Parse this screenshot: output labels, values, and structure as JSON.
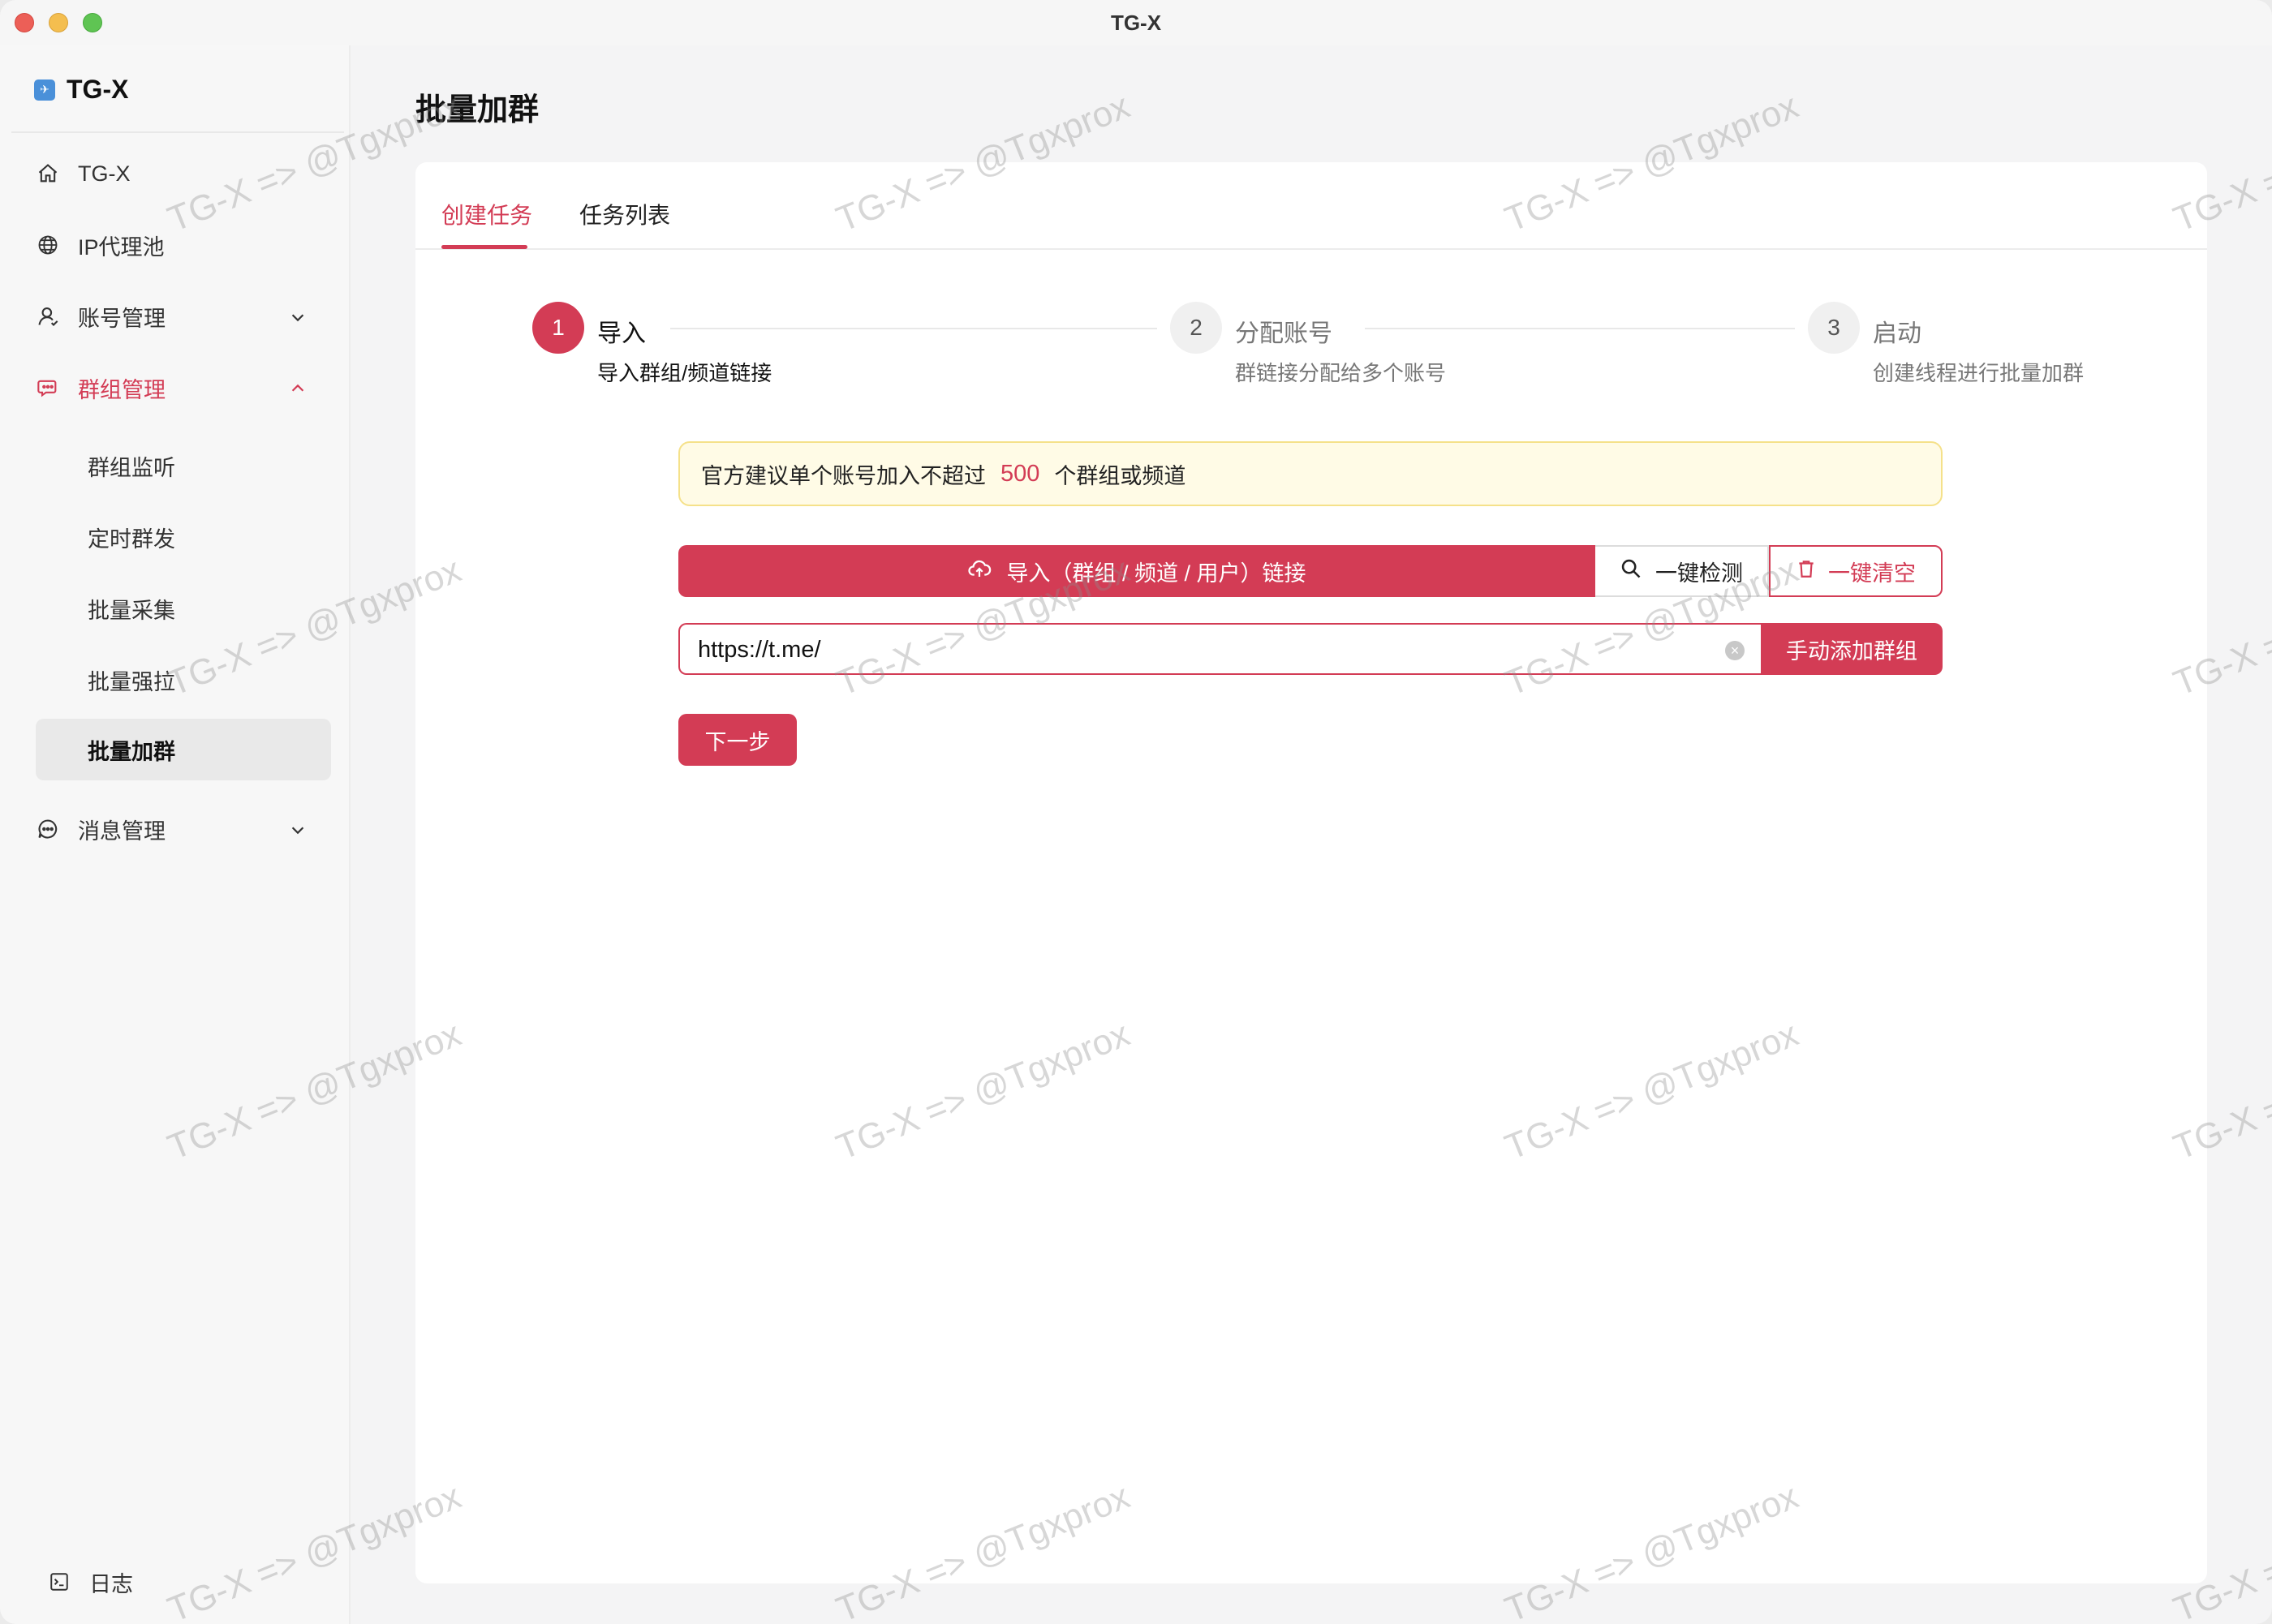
{
  "window": {
    "title": "TG-X"
  },
  "brand": {
    "name": "TG-X"
  },
  "sidebar": {
    "items": [
      {
        "label": "TG-X",
        "icon": "home-icon"
      },
      {
        "label": "IP代理池",
        "icon": "globe-icon"
      },
      {
        "label": "账号管理",
        "icon": "user-icon"
      },
      {
        "label": "群组管理",
        "icon": "chat-group-icon"
      },
      {
        "label": "消息管理",
        "icon": "message-icon"
      }
    ],
    "sub_items": [
      "群组监听",
      "定时群发",
      "批量采集",
      "批量强拉",
      "批量加群"
    ],
    "log_label": "日志"
  },
  "page": {
    "title": "批量加群"
  },
  "tabs": [
    "创建任务",
    "任务列表"
  ],
  "steps": [
    {
      "num": "1",
      "title": "导入",
      "desc": "导入群组/频道链接"
    },
    {
      "num": "2",
      "title": "分配账号",
      "desc": "群链接分配给多个账号"
    },
    {
      "num": "3",
      "title": "启动",
      "desc": "创建线程进行批量加群"
    }
  ],
  "notice": {
    "prefix": "官方建议单个账号加入不超过",
    "number": "500",
    "suffix": "个群组或频道"
  },
  "actions": {
    "import_label": "导入（群组 / 频道 / 用户）链接",
    "check_label": "一键检测",
    "clear_label": "一键清空"
  },
  "link_input": {
    "value": "https://t.me/",
    "add_label": "手动添加群组"
  },
  "next_label": "下一步",
  "watermark": "TG-X => @Tgxprox",
  "colors": {
    "accent": "#d33c55",
    "notice_bg": "#fffbe6"
  }
}
